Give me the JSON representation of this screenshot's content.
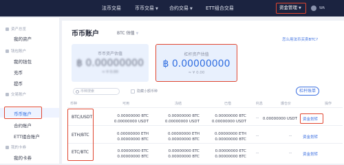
{
  "topnav": {
    "items": [
      "法币交易",
      "币币交易",
      "合约交易",
      "ETT组合交易"
    ],
    "fund_management": "资金管理",
    "user": "WA"
  },
  "sidebar": {
    "sections": [
      {
        "title": "资产总览",
        "items": [
          "我的资产"
        ]
      },
      {
        "title": "钱包账户",
        "items": [
          "我的钱包",
          "充币",
          "提币"
        ]
      },
      {
        "title": "交易账户",
        "items": [
          "币币账户",
          "合约账户",
          "ETT组合账户"
        ]
      },
      {
        "title": "我的卡券",
        "items": [
          "我的卡券"
        ]
      }
    ],
    "active_item": "币币账户"
  },
  "main": {
    "title": "币币账户",
    "valuation_label": "BTC 估值",
    "help_link": "怎么用法币买卖BTC?",
    "card1": {
      "label": "币币资产估值",
      "value": "฿ 0.00000000",
      "sub": "≈ ¥ 0.00"
    },
    "card2": {
      "label": "杠杆资产估值",
      "value": "฿ 0.00000000",
      "sub": "≈ ¥ 0.00"
    },
    "search_placeholder": "币种搜索",
    "hide_small": "隐藏小额币种",
    "margin_button": "杠杆账单",
    "columns": [
      "币种",
      "可用",
      "冻结",
      "已借",
      "利息",
      "爆仓价",
      "操作"
    ],
    "rows": [
      {
        "pair": "BTC/USDT",
        "available": [
          "0.00000000 BTC",
          "0.00000000 USDT"
        ],
        "frozen": [
          "0.00000000 BTC",
          "0.00000000 USDT"
        ],
        "borrowed": [
          "0.00000000 BTC",
          "0.00000000 USDT"
        ],
        "interest": "--",
        "liquidation": "0.00000000 USDT",
        "action": "资金划转"
      },
      {
        "pair": "ETH/BTC",
        "available": [
          "0.00000000 ETH",
          "0.00000000 BTC"
        ],
        "frozen": [
          "0.00000000 ETH",
          "0.00000000 BTC"
        ],
        "borrowed": [
          "0.00000000 ETH",
          "0.00000000 BTC"
        ],
        "interest": "--",
        "liquidation": "--",
        "action": "资金划转"
      },
      {
        "pair": "ETC/BTC",
        "available": [
          "0.00000000 ETC",
          "0.00000000 BTC"
        ],
        "frozen": [
          "0.00000000 ETC",
          "0.00000000 BTC"
        ],
        "borrowed": [
          "0.00000000 ETC",
          "0.00000000 BTC"
        ],
        "interest": "--",
        "liquidation": "--",
        "action": "资金划转"
      }
    ]
  },
  "colors": {
    "nav_bg": "#1b2340",
    "accent": "#2f6de0",
    "highlight": "#e0452f"
  }
}
